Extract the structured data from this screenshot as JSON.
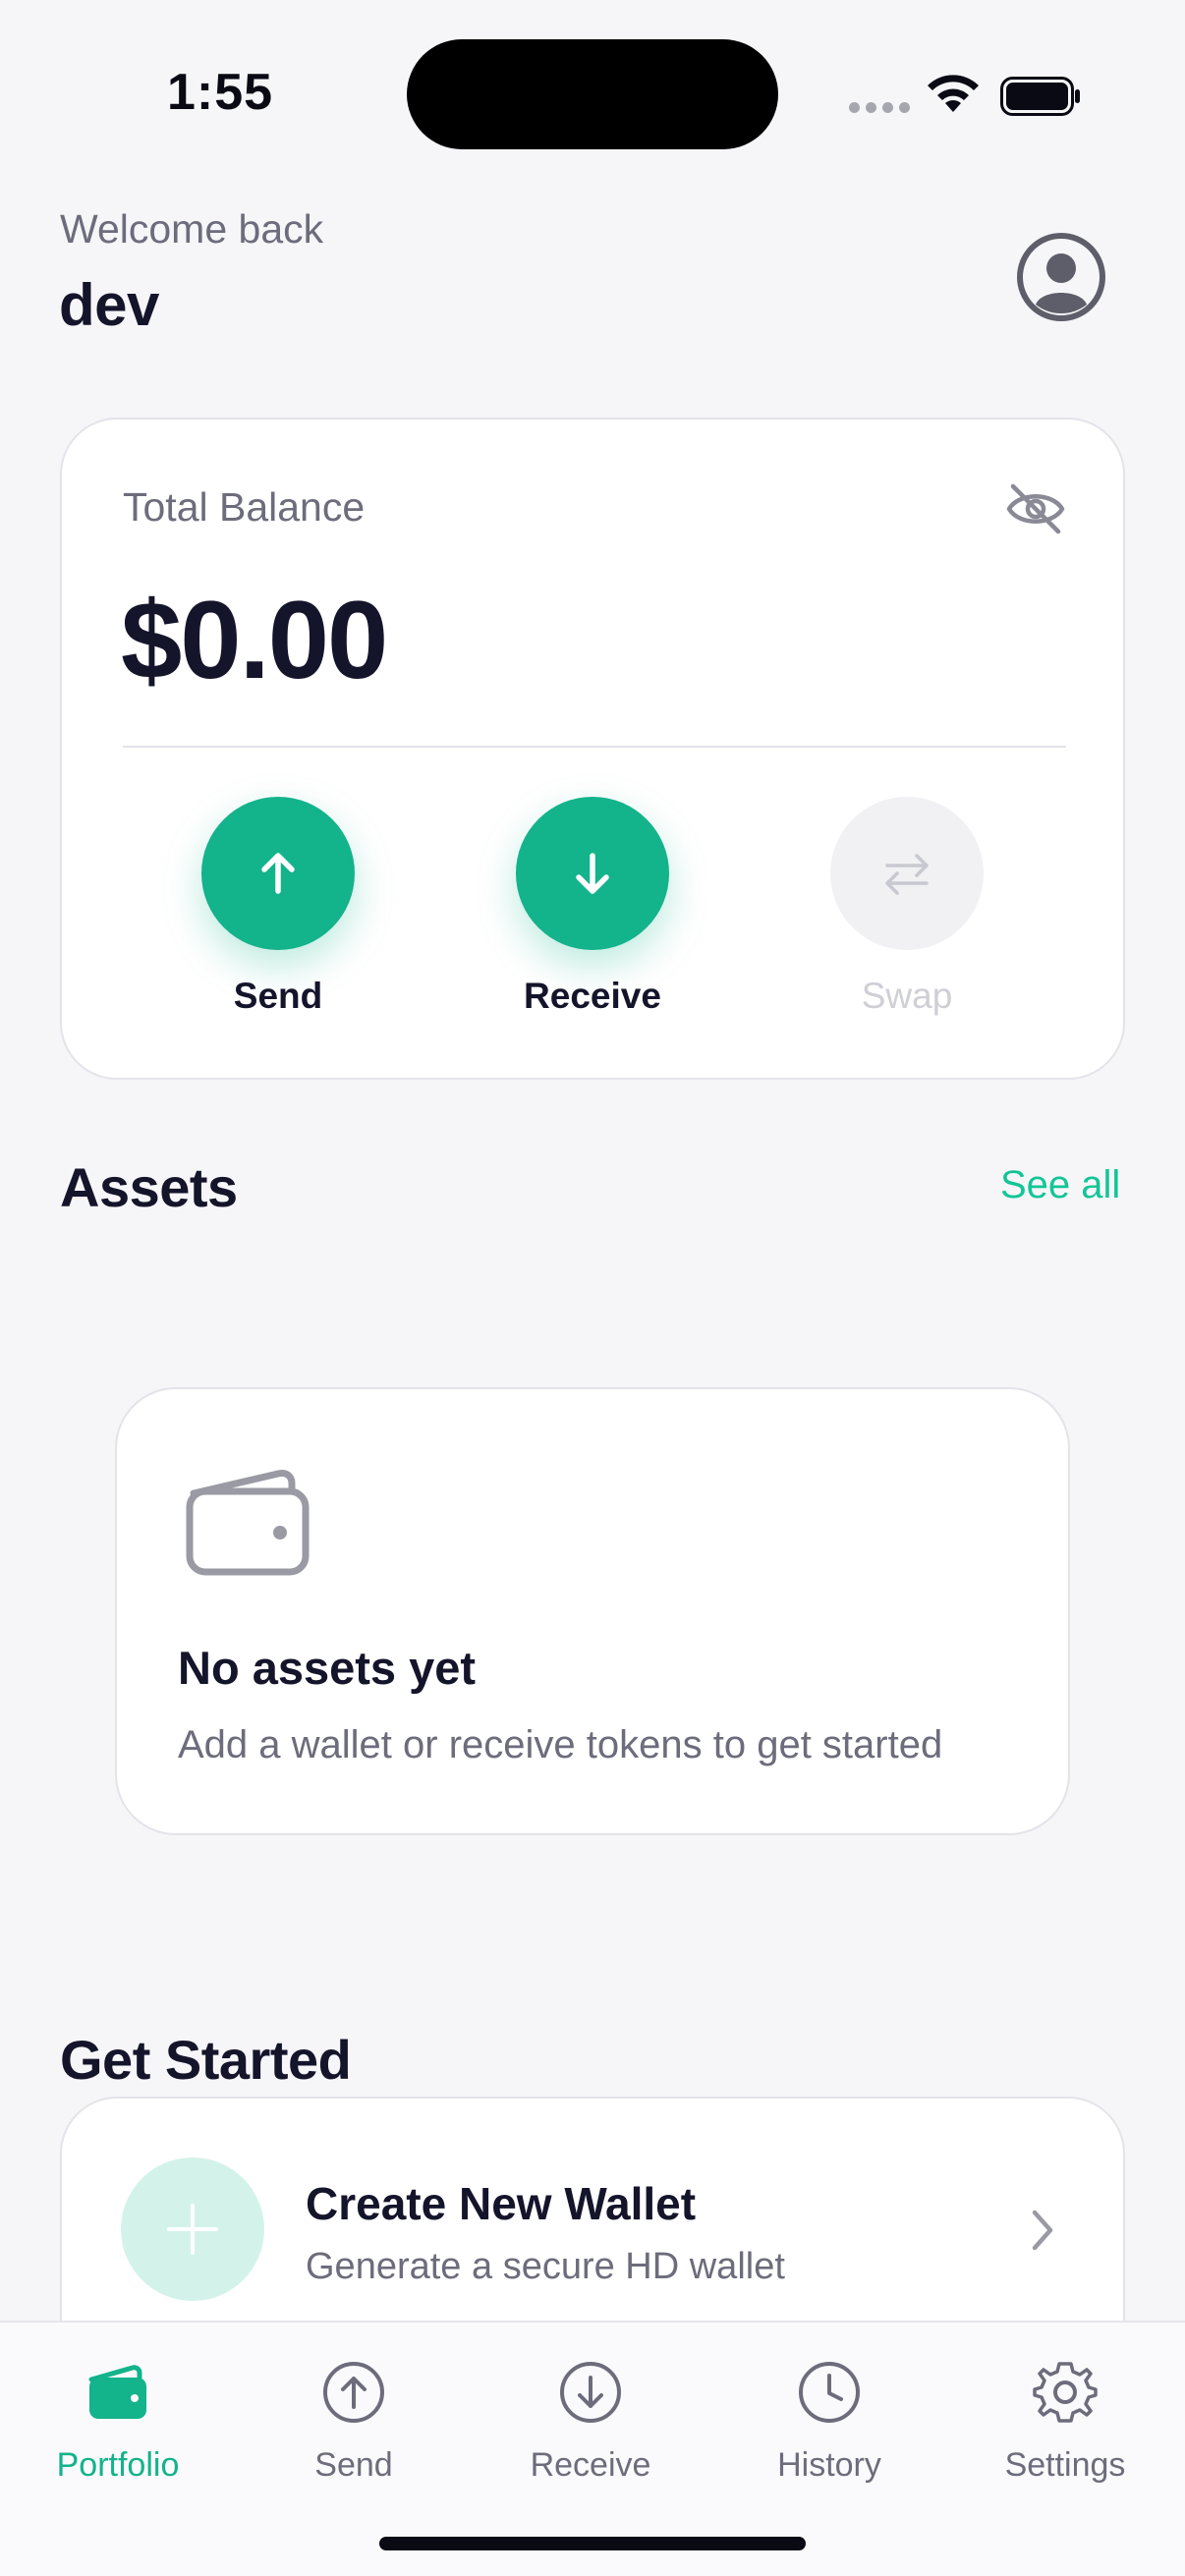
{
  "status_bar": {
    "time": "1:55"
  },
  "header": {
    "welcome": "Welcome back",
    "username": "dev"
  },
  "balance_card": {
    "label": "Total Balance",
    "amount": "$0.00",
    "actions": [
      {
        "label": "Send",
        "enabled": true
      },
      {
        "label": "Receive",
        "enabled": true
      },
      {
        "label": "Swap",
        "enabled": false
      }
    ]
  },
  "assets": {
    "title": "Assets",
    "see_all": "See all",
    "empty_title": "No assets yet",
    "empty_subtitle": "Add a wallet or receive tokens to get started"
  },
  "get_started": {
    "title": "Get Started",
    "items": [
      {
        "title": "Create New Wallet",
        "subtitle": "Generate a secure HD wallet"
      }
    ]
  },
  "tabbar": {
    "items": [
      {
        "label": "Portfolio",
        "active": true
      },
      {
        "label": "Send",
        "active": false
      },
      {
        "label": "Receive",
        "active": false
      },
      {
        "label": "History",
        "active": false
      },
      {
        "label": "Settings",
        "active": false
      }
    ]
  },
  "colors": {
    "accent": "#13b38b",
    "accent_text": "#13c596",
    "background": "#f6f6f9",
    "text_primary": "#14142b",
    "text_secondary": "#6c6c7c"
  }
}
